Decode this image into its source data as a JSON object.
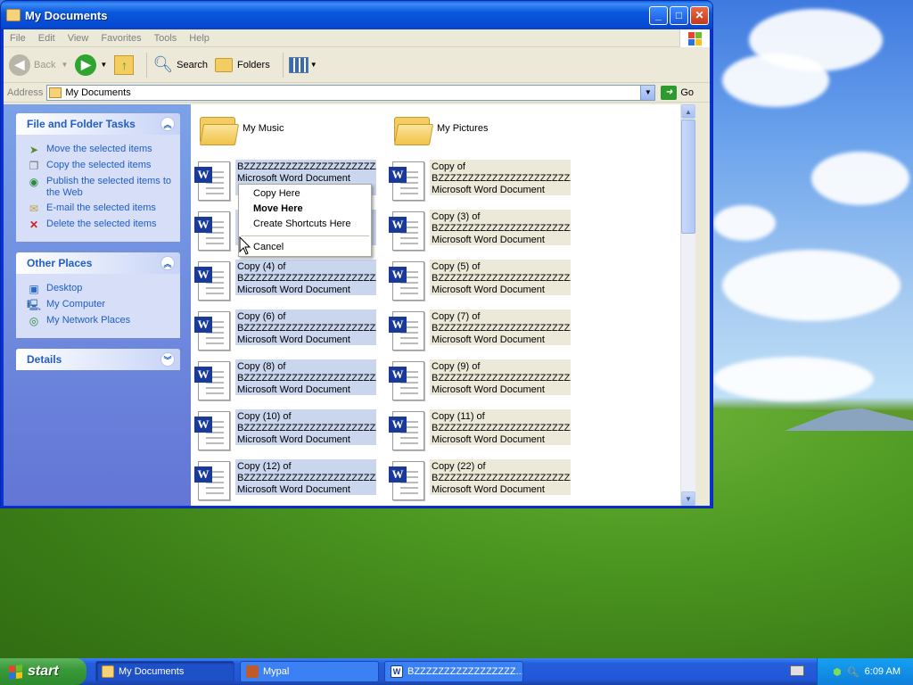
{
  "window": {
    "title": "My Documents",
    "minimize": "_",
    "maximize": "□",
    "close": "✕"
  },
  "menu": [
    "File",
    "Edit",
    "View",
    "Favorites",
    "Tools",
    "Help"
  ],
  "toolbar": {
    "back": "Back",
    "search": "Search",
    "folders": "Folders"
  },
  "address": {
    "label": "Address",
    "value": "My Documents",
    "go": "Go"
  },
  "tasks": {
    "title": "File and Folder Tasks",
    "items": [
      "Move the selected items",
      "Copy the selected items",
      "Publish the selected items to the Web",
      "E-mail the selected items",
      "Delete the selected items"
    ]
  },
  "places": {
    "title": "Other Places",
    "items": [
      "Desktop",
      "My Computer",
      "My Network Places"
    ]
  },
  "details": {
    "title": "Details"
  },
  "folders": [
    "My Music",
    "My Pictures"
  ],
  "files": [
    {
      "l1": "BZZZZZZZZZZZZZZZZZZZZZZZ...",
      "l2": "Microsoft Word Document"
    },
    {
      "l1": "Copy of",
      "l2": "BZZZZZZZZZZZZZZZZZZZZZZZ...",
      "l3": "Microsoft Word Document"
    },
    {
      "l1": "",
      "l2": "",
      "l3": ""
    },
    {
      "l1": "Copy (3) of",
      "l2": "BZZZZZZZZZZZZZZZZZZZZZZZ...",
      "l3": "Microsoft Word Document"
    },
    {
      "l1": "Copy (4) of",
      "l2": "BZZZZZZZZZZZZZZZZZZZZZZZ...",
      "l3": "Microsoft Word Document"
    },
    {
      "l1": "Copy (5) of",
      "l2": "BZZZZZZZZZZZZZZZZZZZZZZZ...",
      "l3": "Microsoft Word Document"
    },
    {
      "l1": "Copy (6) of",
      "l2": "BZZZZZZZZZZZZZZZZZZZZZZZ...",
      "l3": "Microsoft Word Document"
    },
    {
      "l1": "Copy (7) of",
      "l2": "BZZZZZZZZZZZZZZZZZZZZZZZ...",
      "l3": "Microsoft Word Document"
    },
    {
      "l1": "Copy (8) of",
      "l2": "BZZZZZZZZZZZZZZZZZZZZZZZ...",
      "l3": "Microsoft Word Document"
    },
    {
      "l1": "Copy (9) of",
      "l2": "BZZZZZZZZZZZZZZZZZZZZZZZ...",
      "l3": "Microsoft Word Document"
    },
    {
      "l1": "Copy (10) of",
      "l2": "BZZZZZZZZZZZZZZZZZZZZZZZ...",
      "l3": "Microsoft Word Document"
    },
    {
      "l1": "Copy (11) of",
      "l2": "BZZZZZZZZZZZZZZZZZZZZZZZ...",
      "l3": "Microsoft Word Document"
    },
    {
      "l1": "Copy (12) of",
      "l2": "BZZZZZZZZZZZZZZZZZZZZZZZ...",
      "l3": "Microsoft Word Document"
    },
    {
      "l1": "Copy (22) of",
      "l2": "BZZZZZZZZZZZZZZZZZZZZZZZ...",
      "l3": "Microsoft Word Document"
    }
  ],
  "context_menu": {
    "copy": "Copy Here",
    "move": "Move Here",
    "shortcut": "Create Shortcuts Here",
    "cancel": "Cancel"
  },
  "taskbar": {
    "start": "start",
    "tasks": [
      "My Documents",
      "Mypal",
      "BZZZZZZZZZZZZZZZZZ..."
    ],
    "clock": "6:09 AM"
  }
}
